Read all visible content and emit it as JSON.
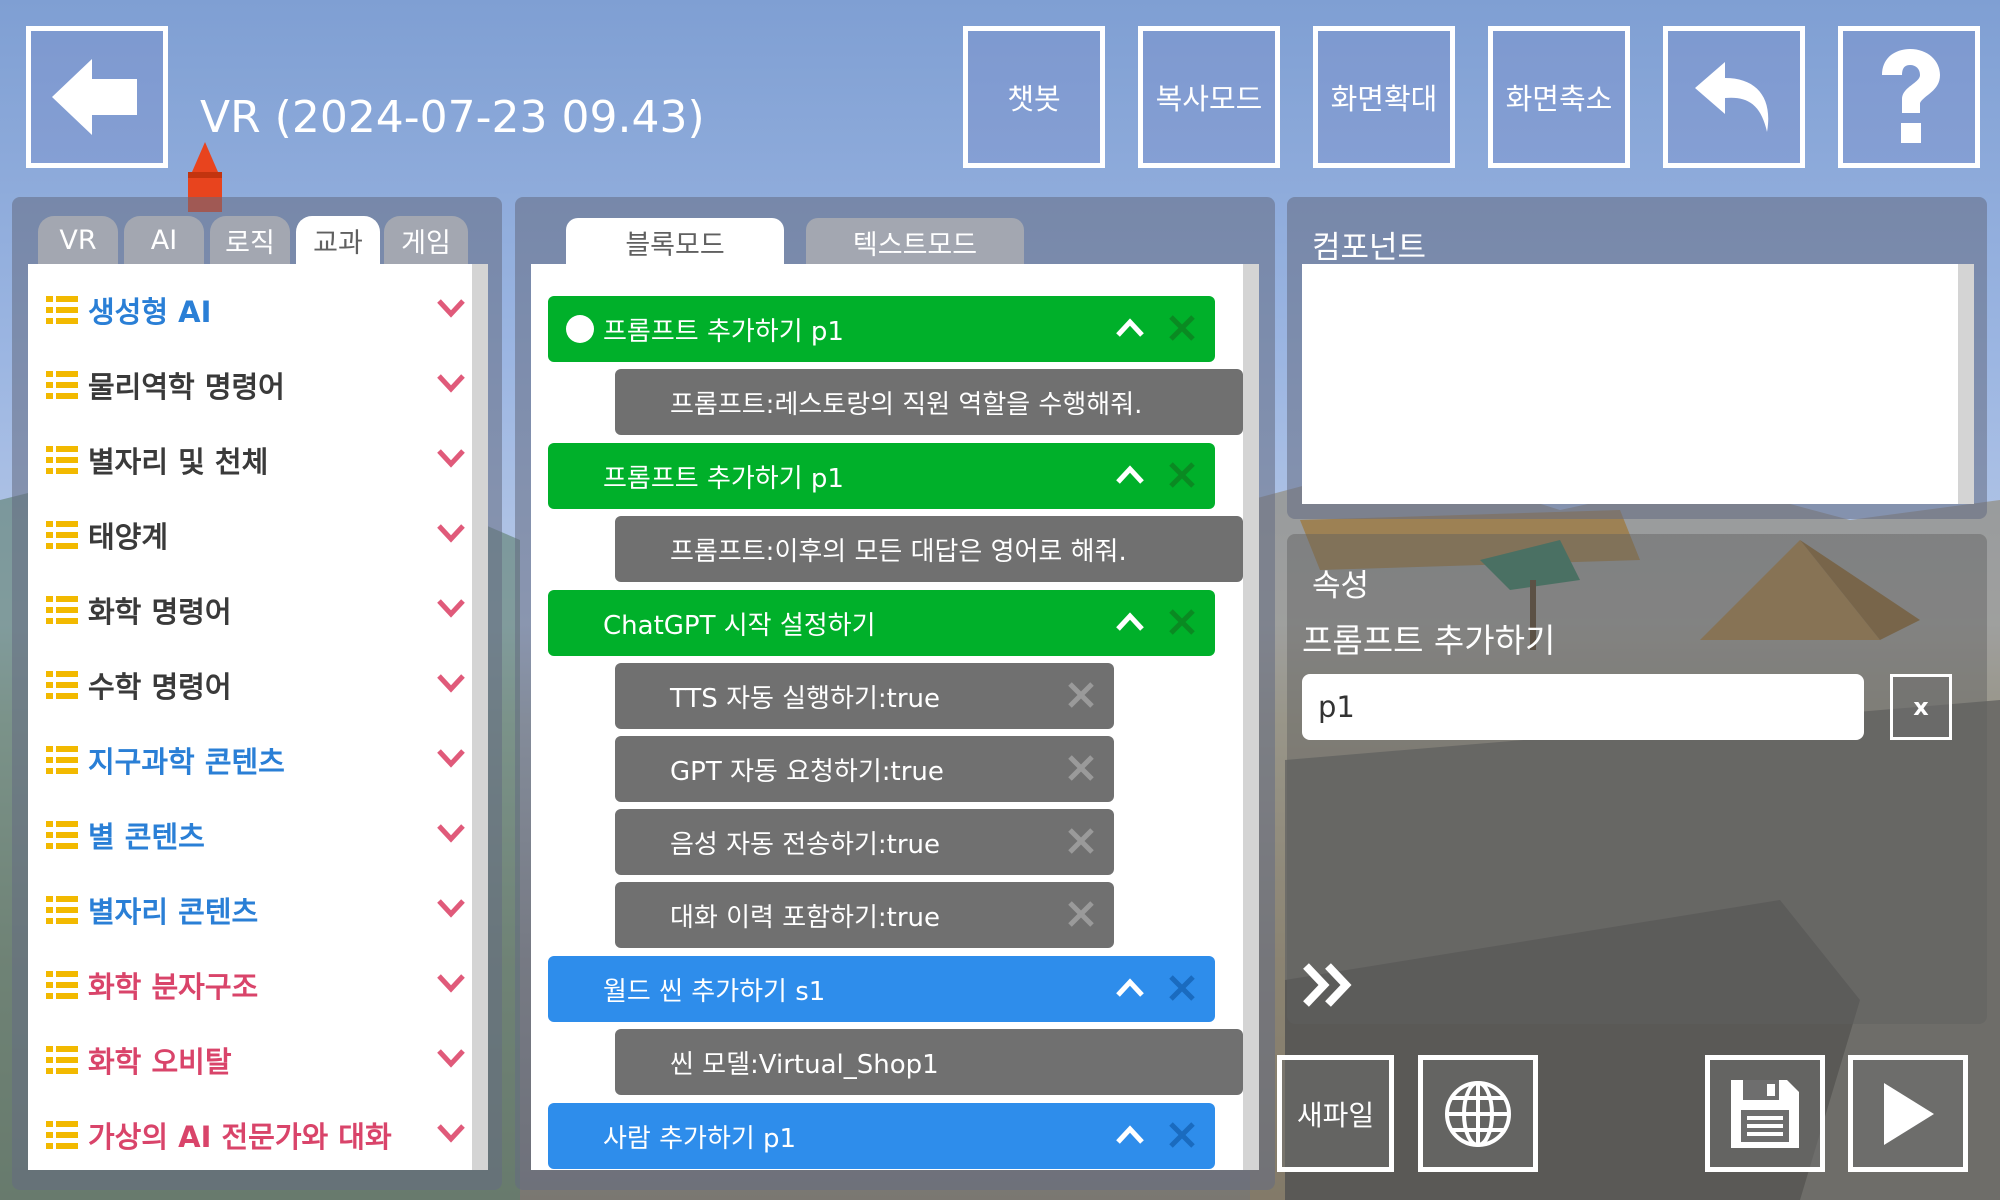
{
  "header": {
    "title": "VR (2024-07-23 09.43)",
    "buttons": [
      "챗봇",
      "복사모드",
      "화면확대",
      "화면축소"
    ]
  },
  "left_panel": {
    "tabs": [
      "VR",
      "AI",
      "로직",
      "교과",
      "게임"
    ],
    "active_tab": "교과",
    "categories": [
      {
        "label": "생성형 AI",
        "color": "#2a7fd6"
      },
      {
        "label": "물리역학 명령어",
        "color": "#3a3a3a"
      },
      {
        "label": "별자리 및 천체",
        "color": "#3a3a3a"
      },
      {
        "label": "태양계",
        "color": "#3a3a3a"
      },
      {
        "label": "화학 명령어",
        "color": "#3a3a3a"
      },
      {
        "label": "수학 명령어",
        "color": "#3a3a3a"
      },
      {
        "label": "지구과학 콘텐츠",
        "color": "#2a7fd6"
      },
      {
        "label": "별 콘텐츠",
        "color": "#2a7fd6"
      },
      {
        "label": "별자리 콘텐츠",
        "color": "#2a7fd6"
      },
      {
        "label": "화학 분자구조",
        "color": "#d9446a"
      },
      {
        "label": "화학 오비탈",
        "color": "#d9446a"
      },
      {
        "label": "가상의 AI 전문가와 대화",
        "color": "#d9446a"
      }
    ]
  },
  "center_panel": {
    "tabs": [
      "블록모드",
      "텍스트모드"
    ],
    "active_tab": "블록모드",
    "blocks": [
      {
        "kind": "green",
        "label": "프롬프트 추가하기 p1",
        "circle": true
      },
      {
        "kind": "gray",
        "label": "프롬프트:레스토랑의 직원 역할을 수행해줘."
      },
      {
        "kind": "green",
        "label": "프롬프트 추가하기 p1"
      },
      {
        "kind": "gray",
        "label": "프롬프트:이후의 모든 대답은 영어로 해줘."
      },
      {
        "kind": "green",
        "label": "ChatGPT 시작 설정하기"
      },
      {
        "kind": "gray-x",
        "label": "TTS 자동 실행하기:true"
      },
      {
        "kind": "gray-x",
        "label": "GPT 자동 요청하기:true"
      },
      {
        "kind": "gray-x",
        "label": "음성 자동 전송하기:true"
      },
      {
        "kind": "gray-x",
        "label": "대화 이력 포함하기:true"
      },
      {
        "kind": "blue",
        "label": "월드 씬 추가하기 s1"
      },
      {
        "kind": "gray",
        "label": "씬 모델:Virtual_Shop1"
      },
      {
        "kind": "blue",
        "label": "사람 추가하기 p1"
      }
    ]
  },
  "right_panel": {
    "components_label": "컴포넌트",
    "properties_label": "속성",
    "property_title": "프롬프트 추가하기",
    "property_value": "p1",
    "clear_label": "x"
  },
  "bottom": {
    "new_file_label": "새파일"
  },
  "colors": {
    "green": "#00b02a",
    "blue": "#2e8deb",
    "gray": "#707070"
  }
}
